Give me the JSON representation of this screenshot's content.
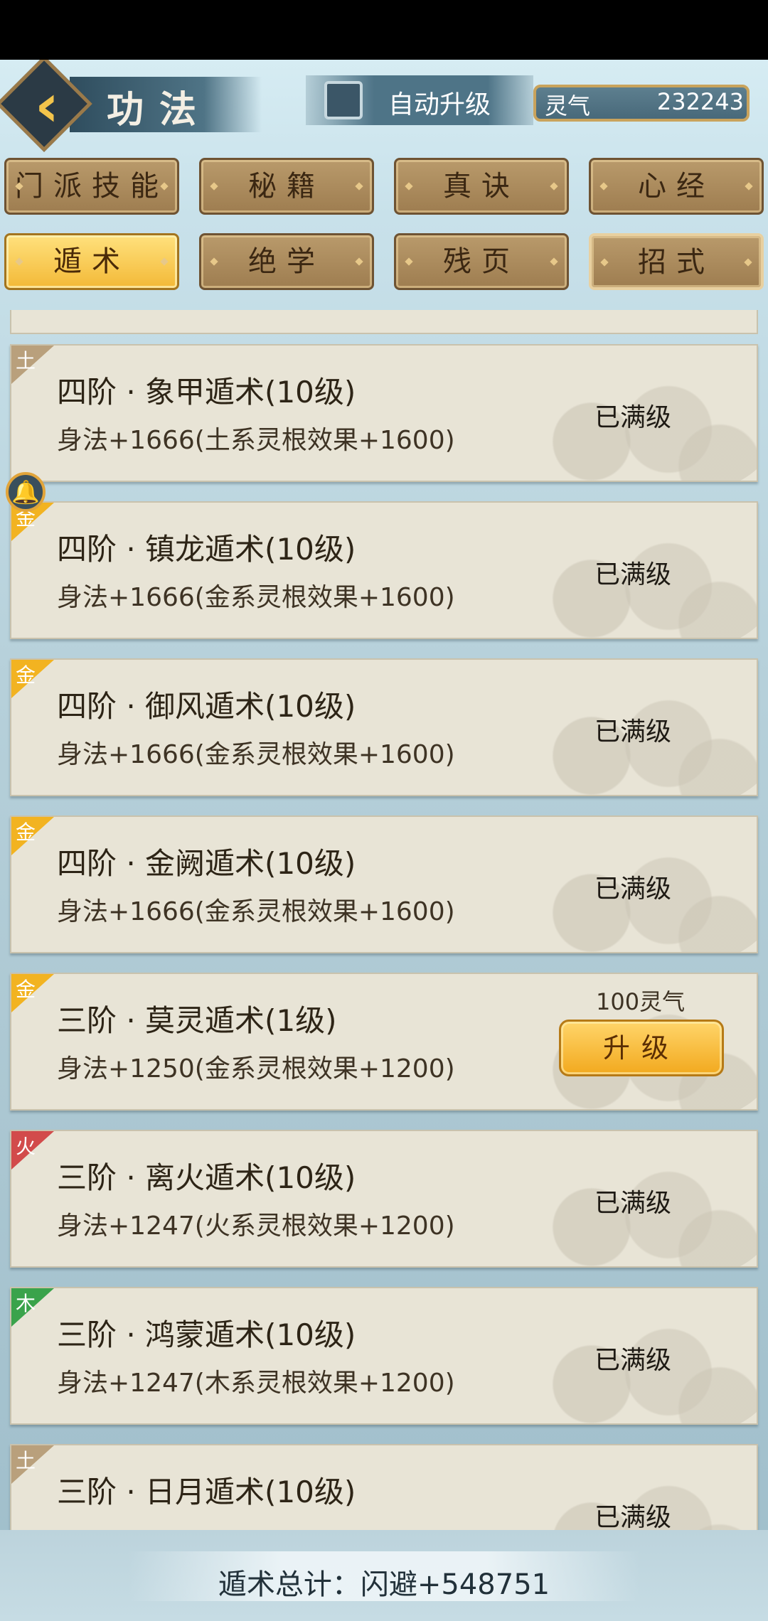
{
  "header": {
    "title": "功法",
    "auto_upgrade_label": "自动升级",
    "qi_label": "灵气",
    "qi_value": "232243"
  },
  "tabs_row1": [
    "门派技能",
    "秘籍",
    "真诀",
    "心经"
  ],
  "tabs_row2": [
    "遁术",
    "绝学",
    "残页",
    "招式"
  ],
  "active_tab": "遁术",
  "items": [
    {
      "tag": "土",
      "tag_color": "#b9a07c",
      "name": "四阶 · 象甲遁术(10级)",
      "effect": "身法+1666(土系灵根效果+1600)",
      "status": "已满级"
    },
    {
      "tag": "金",
      "tag_color": "#f2b321",
      "name": "四阶 · 镇龙遁术(10级)",
      "effect": "身法+1666(金系灵根效果+1600)",
      "status": "已满级"
    },
    {
      "tag": "金",
      "tag_color": "#f2b321",
      "name": "四阶 · 御风遁术(10级)",
      "effect": "身法+1666(金系灵根效果+1600)",
      "status": "已满级"
    },
    {
      "tag": "金",
      "tag_color": "#f2b321",
      "name": "四阶 · 金阙遁术(10级)",
      "effect": "身法+1666(金系灵根效果+1600)",
      "status": "已满级"
    },
    {
      "tag": "金",
      "tag_color": "#f2b321",
      "name": "三阶 · 莫灵遁术(1级)",
      "effect": "身法+1250(金系灵根效果+1200)",
      "cost": "100灵气",
      "button": "升级"
    },
    {
      "tag": "火",
      "tag_color": "#d24b4b",
      "name": "三阶 · 离火遁术(10级)",
      "effect": "身法+1247(火系灵根效果+1200)",
      "status": "已满级"
    },
    {
      "tag": "木",
      "tag_color": "#3aa34b",
      "name": "三阶 · 鸿蒙遁术(10级)",
      "effect": "身法+1247(木系灵根效果+1200)",
      "status": "已满级"
    },
    {
      "tag": "土",
      "tag_color": "#b9a07c",
      "name": "三阶 · 日月遁术(10级)",
      "status": "已满级"
    }
  ],
  "footer": {
    "total": "遁术总计：闪避+548751"
  }
}
